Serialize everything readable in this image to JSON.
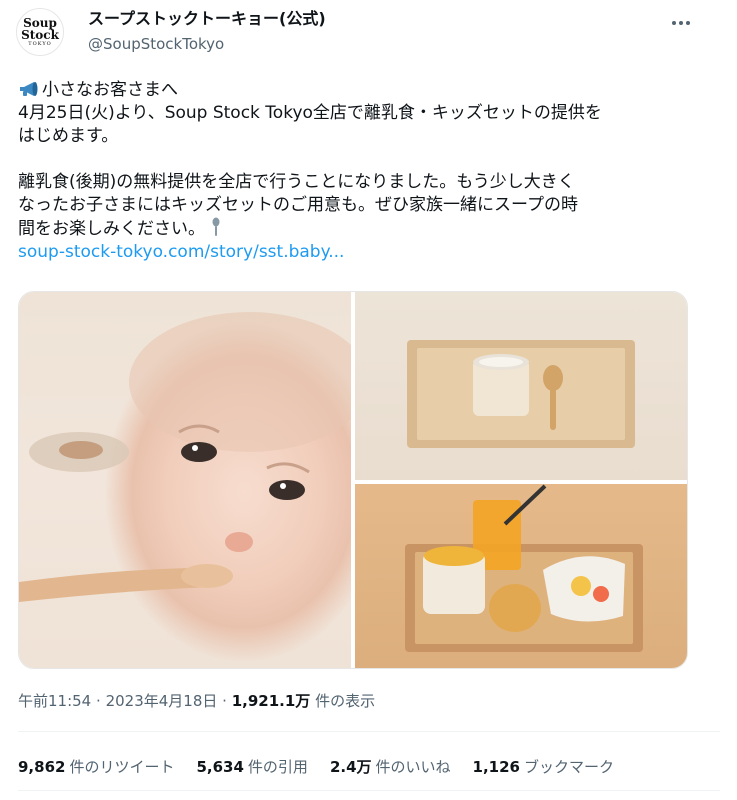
{
  "account": {
    "display_name": "スープストックトーキョー(公式)",
    "handle": "@SoupStockTokyo",
    "avatar_logo": {
      "line1": "Soup",
      "line2": "Stock",
      "line3": "TOKYO"
    }
  },
  "tweet": {
    "lines": [
      "小さなお客さまへ",
      "4月25日(火)より、Soup Stock Tokyo全店で離乳食・キッズセットの提供を",
      "はじめます。",
      "離乳食(後期)の無料提供を全店で行うことになりました。もう少し大きく",
      "なったお子さまにはキッズセットのご用意も。ぜひ家族一緒にスープの時",
      "間をお楽しみください。"
    ],
    "link": "soup-stock-tokyo.com/story/sst.baby..."
  },
  "media": [
    {
      "icon": "photo-baby-spoon"
    },
    {
      "icon": "photo-baby-food-tray"
    },
    {
      "icon": "photo-kids-set-tray"
    }
  ],
  "meta": {
    "time": "午前11:54",
    "date": "2023年4月18日",
    "views_count": "1,921.1万",
    "views_label": "件の表示"
  },
  "stats": {
    "retweets_count": "9,862",
    "retweets_label": "件のリツイート",
    "quotes_count": "5,634",
    "quotes_label": "件の引用",
    "likes_count": "2.4万",
    "likes_label": "件のいいね",
    "bookmarks_count": "1,126",
    "bookmarks_label": "ブックマーク"
  },
  "colors": {
    "link": "#1d9bf0",
    "secondary_text": "#536471",
    "primary_text": "#0f1419"
  }
}
